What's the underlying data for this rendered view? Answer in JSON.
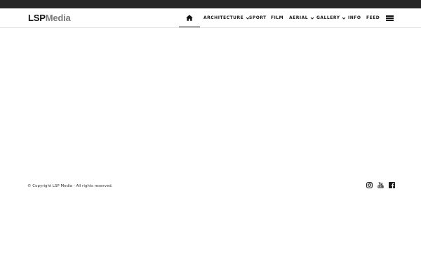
{
  "brand": {
    "logo_strong": "LSP",
    "logo_light": "Media",
    "colors": {
      "top_bar": "#262626",
      "text": "#1a1a1a",
      "logo_light": "#7a7a7a"
    }
  },
  "nav": {
    "home_icon": "home-icon",
    "items": [
      {
        "label": "ARCHITECTURE",
        "has_dropdown": true
      },
      {
        "label": "SPORT",
        "has_dropdown": false
      },
      {
        "label": "FILM",
        "has_dropdown": false
      },
      {
        "label": "AERIAL",
        "has_dropdown": true
      },
      {
        "label": "GALLERY",
        "has_dropdown": true
      },
      {
        "label": "INFO",
        "has_dropdown": false
      },
      {
        "label": "FEED",
        "has_dropdown": false
      }
    ],
    "menu_icon": "hamburger-menu-icon"
  },
  "footer": {
    "copyright": "© Copyright LSP Media - All rights reserved.",
    "social_icons": [
      "instagram-icon",
      "youtube-icon",
      "facebook-icon"
    ]
  }
}
